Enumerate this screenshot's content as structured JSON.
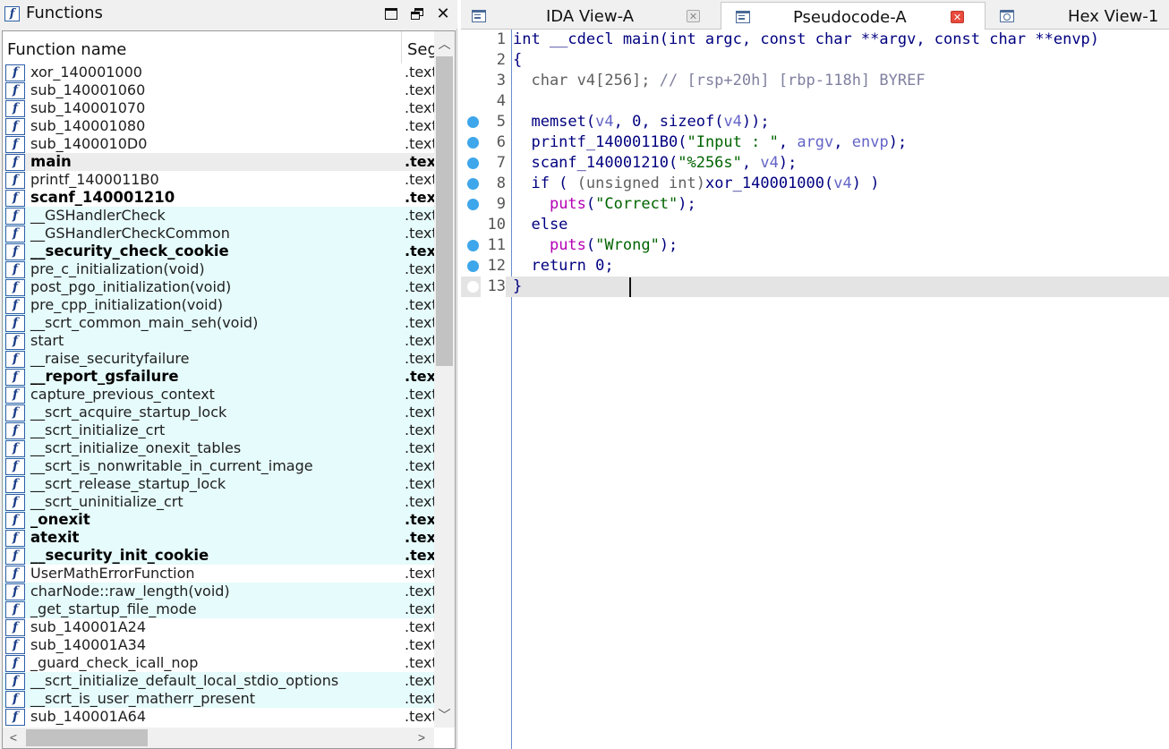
{
  "functions_panel": {
    "title": "Functions",
    "columns": {
      "name": "Function name",
      "segment": "Segment"
    },
    "rows": [
      {
        "name": "xor_140001000",
        "seg": ".text",
        "bold": false,
        "hl": false
      },
      {
        "name": "sub_140001060",
        "seg": ".text",
        "bold": false,
        "hl": false
      },
      {
        "name": "sub_140001070",
        "seg": ".text",
        "bold": false,
        "hl": false
      },
      {
        "name": "sub_140001080",
        "seg": ".text",
        "bold": false,
        "hl": false
      },
      {
        "name": "sub_1400010D0",
        "seg": ".text",
        "bold": false,
        "hl": false
      },
      {
        "name": "main",
        "seg": ".text",
        "bold": true,
        "hl": false,
        "selected": true
      },
      {
        "name": "printf_1400011B0",
        "seg": ".text",
        "bold": false,
        "hl": false
      },
      {
        "name": "scanf_140001210",
        "seg": ".text",
        "bold": true,
        "hl": false
      },
      {
        "name": "__GSHandlerCheck",
        "seg": ".text",
        "bold": false,
        "hl": true
      },
      {
        "name": "__GSHandlerCheckCommon",
        "seg": ".text",
        "bold": false,
        "hl": true
      },
      {
        "name": "__security_check_cookie",
        "seg": ".text",
        "bold": true,
        "hl": true
      },
      {
        "name": "pre_c_initialization(void)",
        "seg": ".text",
        "bold": false,
        "hl": true
      },
      {
        "name": "post_pgo_initialization(void)",
        "seg": ".text",
        "bold": false,
        "hl": true
      },
      {
        "name": "pre_cpp_initialization(void)",
        "seg": ".text",
        "bold": false,
        "hl": true
      },
      {
        "name": "__scrt_common_main_seh(void)",
        "seg": ".text",
        "bold": false,
        "hl": true
      },
      {
        "name": "start",
        "seg": ".text",
        "bold": false,
        "hl": true
      },
      {
        "name": "__raise_securityfailure",
        "seg": ".text",
        "bold": false,
        "hl": true
      },
      {
        "name": "__report_gsfailure",
        "seg": ".text",
        "bold": true,
        "hl": true
      },
      {
        "name": "capture_previous_context",
        "seg": ".text",
        "bold": false,
        "hl": true
      },
      {
        "name": "__scrt_acquire_startup_lock",
        "seg": ".text",
        "bold": false,
        "hl": true
      },
      {
        "name": "__scrt_initialize_crt",
        "seg": ".text",
        "bold": false,
        "hl": true
      },
      {
        "name": "__scrt_initialize_onexit_tables",
        "seg": ".text",
        "bold": false,
        "hl": true
      },
      {
        "name": "__scrt_is_nonwritable_in_current_image",
        "seg": ".text",
        "bold": false,
        "hl": true
      },
      {
        "name": "__scrt_release_startup_lock",
        "seg": ".text",
        "bold": false,
        "hl": true
      },
      {
        "name": "__scrt_uninitialize_crt",
        "seg": ".text",
        "bold": false,
        "hl": true
      },
      {
        "name": "_onexit",
        "seg": ".text",
        "bold": true,
        "hl": true
      },
      {
        "name": "atexit",
        "seg": ".text",
        "bold": true,
        "hl": true
      },
      {
        "name": "__security_init_cookie",
        "seg": ".text",
        "bold": true,
        "hl": true
      },
      {
        "name": "UserMathErrorFunction",
        "seg": ".text",
        "bold": false,
        "hl": false
      },
      {
        "name": "charNode::raw_length(void)",
        "seg": ".text",
        "bold": false,
        "hl": true
      },
      {
        "name": "_get_startup_file_mode",
        "seg": ".text",
        "bold": false,
        "hl": true
      },
      {
        "name": "sub_140001A24",
        "seg": ".text",
        "bold": false,
        "hl": false
      },
      {
        "name": "sub_140001A34",
        "seg": ".text",
        "bold": false,
        "hl": false
      },
      {
        "name": "_guard_check_icall_nop",
        "seg": ".text",
        "bold": false,
        "hl": false
      },
      {
        "name": "__scrt_initialize_default_local_stdio_options",
        "seg": ".text",
        "bold": false,
        "hl": true
      },
      {
        "name": "__scrt_is_user_matherr_present",
        "seg": ".text",
        "bold": false,
        "hl": true
      },
      {
        "name": "sub_140001A64",
        "seg": ".text",
        "bold": false,
        "hl": false
      }
    ]
  },
  "tabs": [
    {
      "label": "IDA View-A",
      "icon": "doc-icon",
      "active": false
    },
    {
      "label": "Pseudocode-A",
      "icon": "doc-icon",
      "active": true
    },
    {
      "label": "Hex View-1",
      "icon": "hex-icon",
      "active": false
    }
  ],
  "pseudocode": {
    "lines": [
      {
        "n": "1",
        "bp": false,
        "tokens": [
          [
            "t-plain",
            "int __cdecl main(int argc, const char **argv, const char **envp)"
          ]
        ]
      },
      {
        "n": "2",
        "bp": false,
        "tokens": [
          [
            "t-plain",
            "{"
          ]
        ]
      },
      {
        "n": "3",
        "bp": false,
        "tokens": [
          [
            "t-dim",
            "  char v4[256]; "
          ],
          [
            "t-comment",
            "// [rsp+20h] [rbp-118h] BYREF"
          ]
        ]
      },
      {
        "n": "4",
        "bp": false,
        "tokens": []
      },
      {
        "n": "5",
        "bp": true,
        "tokens": [
          [
            "t-plain",
            "  memset("
          ],
          [
            "t-var",
            "v4"
          ],
          [
            "t-plain",
            ", 0, sizeof("
          ],
          [
            "t-var",
            "v4"
          ],
          [
            "t-plain",
            "));"
          ]
        ]
      },
      {
        "n": "6",
        "bp": true,
        "tokens": [
          [
            "t-plain",
            "  printf_1400011B0("
          ],
          [
            "t-str",
            "\"Input : \""
          ],
          [
            "t-plain",
            ", "
          ],
          [
            "t-var",
            "argv"
          ],
          [
            "t-plain",
            ", "
          ],
          [
            "t-var",
            "envp"
          ],
          [
            "t-plain",
            ");"
          ]
        ]
      },
      {
        "n": "7",
        "bp": true,
        "tokens": [
          [
            "t-plain",
            "  scanf_140001210("
          ],
          [
            "t-str",
            "\"%256s\""
          ],
          [
            "t-plain",
            ", "
          ],
          [
            "t-var",
            "v4"
          ],
          [
            "t-plain",
            ");"
          ]
        ]
      },
      {
        "n": "8",
        "bp": true,
        "tokens": [
          [
            "t-plain",
            "  if ( "
          ],
          [
            "t-dim",
            "(unsigned int)"
          ],
          [
            "t-plain",
            "xor_140001000("
          ],
          [
            "t-var",
            "v4"
          ],
          [
            "t-plain",
            ") )"
          ]
        ]
      },
      {
        "n": "9",
        "bp": true,
        "tokens": [
          [
            "t-plain",
            "    "
          ],
          [
            "t-call",
            "puts"
          ],
          [
            "t-plain",
            "("
          ],
          [
            "t-str",
            "\"Correct\""
          ],
          [
            "t-plain",
            ");"
          ]
        ]
      },
      {
        "n": "10",
        "bp": false,
        "tokens": [
          [
            "t-plain",
            "  else"
          ]
        ]
      },
      {
        "n": "11",
        "bp": true,
        "tokens": [
          [
            "t-plain",
            "    "
          ],
          [
            "t-call",
            "puts"
          ],
          [
            "t-plain",
            "("
          ],
          [
            "t-str",
            "\"Wrong\""
          ],
          [
            "t-plain",
            ");"
          ]
        ]
      },
      {
        "n": "12",
        "bp": true,
        "tokens": [
          [
            "t-plain",
            "  return 0;"
          ]
        ]
      },
      {
        "n": "13",
        "bp": true,
        "tokens": [
          [
            "t-plain",
            "}"
          ]
        ],
        "current": true
      }
    ]
  },
  "colors": {
    "highlight_row": "#e6fbfb",
    "breakpoint": "#3ea6ea",
    "code_text": "#000080",
    "string": "#006400",
    "comment": "#8080a0",
    "close_tab_active": "#e94a3c"
  }
}
